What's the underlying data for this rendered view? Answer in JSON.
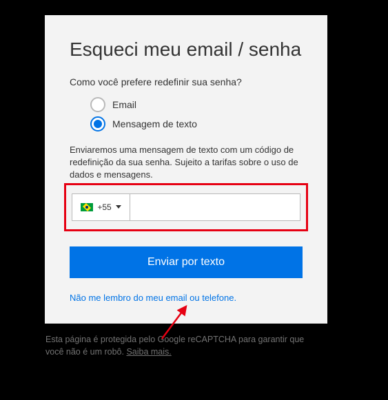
{
  "card": {
    "title": "Esqueci meu email / senha",
    "question": "Como você prefere redefinir sua senha?",
    "options": {
      "email": "Email",
      "sms": "Mensagem de texto"
    },
    "helper_text": "Enviaremos uma mensagem de texto com um código de redefinição da sua senha. Sujeito a tarifas sobre o uso de dados e mensagens.",
    "phone": {
      "country_code": "+55",
      "value": ""
    },
    "submit_label": "Enviar por texto",
    "help_link": "Não me lembro do meu email ou telefone."
  },
  "footer": {
    "text_before": "Esta página é protegida pelo Google reCAPTCHA para garantir que você não é um robô. ",
    "link": "Saiba mais."
  }
}
